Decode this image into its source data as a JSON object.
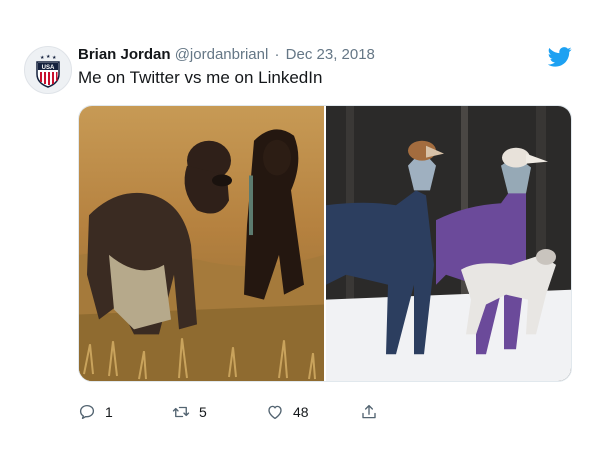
{
  "tweet": {
    "author_name": "Brian Jordan",
    "handle": "@jordanbrianl",
    "separator": "·",
    "date": "Dec 23, 2018",
    "text": "Me on Twitter vs me on LinkedIn",
    "avatar_text": "USA",
    "counts": {
      "replies": "1",
      "retweets": "5",
      "likes": "48"
    }
  },
  "icons": {
    "brand": "twitter-bird-icon",
    "reply": "reply-icon",
    "retweet": "retweet-icon",
    "like": "heart-icon",
    "share": "share-icon"
  },
  "colors": {
    "brand_blue": "#1DA1F2",
    "text": "#14171a",
    "muted": "#657786"
  }
}
